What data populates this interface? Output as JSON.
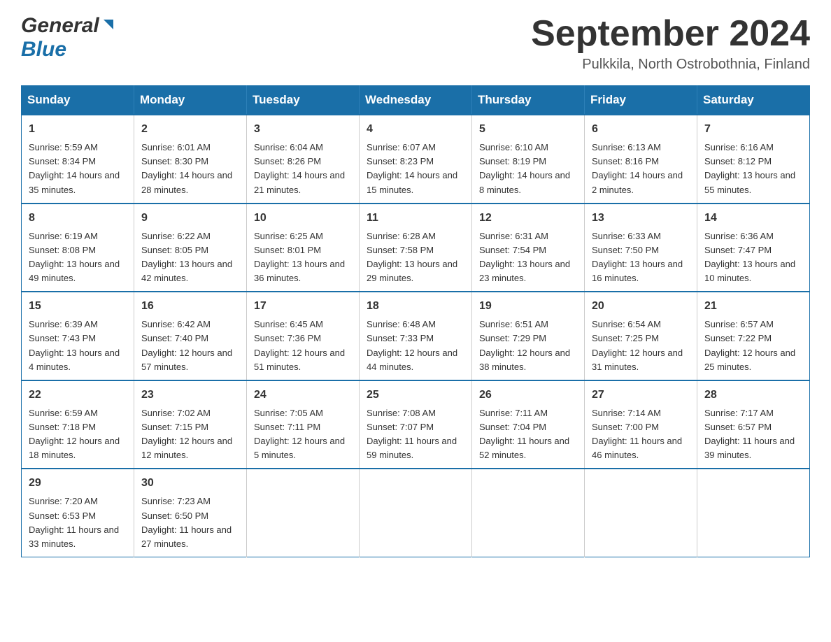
{
  "header": {
    "logo_general": "General",
    "logo_blue": "Blue",
    "month_title": "September 2024",
    "location": "Pulkkila, North Ostrobothnia, Finland"
  },
  "days_of_week": [
    "Sunday",
    "Monday",
    "Tuesday",
    "Wednesday",
    "Thursday",
    "Friday",
    "Saturday"
  ],
  "weeks": [
    [
      {
        "day": "1",
        "sunrise": "5:59 AM",
        "sunset": "8:34 PM",
        "daylight": "14 hours and 35 minutes."
      },
      {
        "day": "2",
        "sunrise": "6:01 AM",
        "sunset": "8:30 PM",
        "daylight": "14 hours and 28 minutes."
      },
      {
        "day": "3",
        "sunrise": "6:04 AM",
        "sunset": "8:26 PM",
        "daylight": "14 hours and 21 minutes."
      },
      {
        "day": "4",
        "sunrise": "6:07 AM",
        "sunset": "8:23 PM",
        "daylight": "14 hours and 15 minutes."
      },
      {
        "day": "5",
        "sunrise": "6:10 AM",
        "sunset": "8:19 PM",
        "daylight": "14 hours and 8 minutes."
      },
      {
        "day": "6",
        "sunrise": "6:13 AM",
        "sunset": "8:16 PM",
        "daylight": "14 hours and 2 minutes."
      },
      {
        "day": "7",
        "sunrise": "6:16 AM",
        "sunset": "8:12 PM",
        "daylight": "13 hours and 55 minutes."
      }
    ],
    [
      {
        "day": "8",
        "sunrise": "6:19 AM",
        "sunset": "8:08 PM",
        "daylight": "13 hours and 49 minutes."
      },
      {
        "day": "9",
        "sunrise": "6:22 AM",
        "sunset": "8:05 PM",
        "daylight": "13 hours and 42 minutes."
      },
      {
        "day": "10",
        "sunrise": "6:25 AM",
        "sunset": "8:01 PM",
        "daylight": "13 hours and 36 minutes."
      },
      {
        "day": "11",
        "sunrise": "6:28 AM",
        "sunset": "7:58 PM",
        "daylight": "13 hours and 29 minutes."
      },
      {
        "day": "12",
        "sunrise": "6:31 AM",
        "sunset": "7:54 PM",
        "daylight": "13 hours and 23 minutes."
      },
      {
        "day": "13",
        "sunrise": "6:33 AM",
        "sunset": "7:50 PM",
        "daylight": "13 hours and 16 minutes."
      },
      {
        "day": "14",
        "sunrise": "6:36 AM",
        "sunset": "7:47 PM",
        "daylight": "13 hours and 10 minutes."
      }
    ],
    [
      {
        "day": "15",
        "sunrise": "6:39 AM",
        "sunset": "7:43 PM",
        "daylight": "13 hours and 4 minutes."
      },
      {
        "day": "16",
        "sunrise": "6:42 AM",
        "sunset": "7:40 PM",
        "daylight": "12 hours and 57 minutes."
      },
      {
        "day": "17",
        "sunrise": "6:45 AM",
        "sunset": "7:36 PM",
        "daylight": "12 hours and 51 minutes."
      },
      {
        "day": "18",
        "sunrise": "6:48 AM",
        "sunset": "7:33 PM",
        "daylight": "12 hours and 44 minutes."
      },
      {
        "day": "19",
        "sunrise": "6:51 AM",
        "sunset": "7:29 PM",
        "daylight": "12 hours and 38 minutes."
      },
      {
        "day": "20",
        "sunrise": "6:54 AM",
        "sunset": "7:25 PM",
        "daylight": "12 hours and 31 minutes."
      },
      {
        "day": "21",
        "sunrise": "6:57 AM",
        "sunset": "7:22 PM",
        "daylight": "12 hours and 25 minutes."
      }
    ],
    [
      {
        "day": "22",
        "sunrise": "6:59 AM",
        "sunset": "7:18 PM",
        "daylight": "12 hours and 18 minutes."
      },
      {
        "day": "23",
        "sunrise": "7:02 AM",
        "sunset": "7:15 PM",
        "daylight": "12 hours and 12 minutes."
      },
      {
        "day": "24",
        "sunrise": "7:05 AM",
        "sunset": "7:11 PM",
        "daylight": "12 hours and 5 minutes."
      },
      {
        "day": "25",
        "sunrise": "7:08 AM",
        "sunset": "7:07 PM",
        "daylight": "11 hours and 59 minutes."
      },
      {
        "day": "26",
        "sunrise": "7:11 AM",
        "sunset": "7:04 PM",
        "daylight": "11 hours and 52 minutes."
      },
      {
        "day": "27",
        "sunrise": "7:14 AM",
        "sunset": "7:00 PM",
        "daylight": "11 hours and 46 minutes."
      },
      {
        "day": "28",
        "sunrise": "7:17 AM",
        "sunset": "6:57 PM",
        "daylight": "11 hours and 39 minutes."
      }
    ],
    [
      {
        "day": "29",
        "sunrise": "7:20 AM",
        "sunset": "6:53 PM",
        "daylight": "11 hours and 33 minutes."
      },
      {
        "day": "30",
        "sunrise": "7:23 AM",
        "sunset": "6:50 PM",
        "daylight": "11 hours and 27 minutes."
      },
      null,
      null,
      null,
      null,
      null
    ]
  ],
  "labels": {
    "sunrise": "Sunrise:",
    "sunset": "Sunset:",
    "daylight": "Daylight:"
  }
}
